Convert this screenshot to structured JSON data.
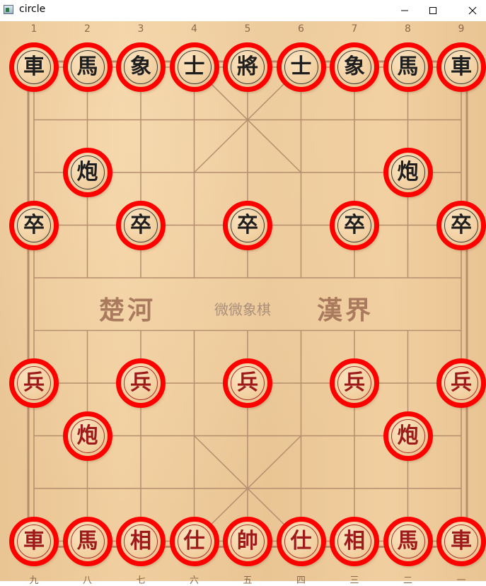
{
  "window": {
    "title": "circle",
    "buttons": [
      "minimize",
      "maximize",
      "close"
    ]
  },
  "board": {
    "top_numbers": [
      "1",
      "2",
      "3",
      "4",
      "5",
      "6",
      "7",
      "8",
      "9"
    ],
    "bottom_numbers": [
      "九",
      "八",
      "七",
      "六",
      "五",
      "四",
      "三",
      "二",
      "一"
    ],
    "river_left": "楚河",
    "river_center": "微微象棋",
    "river_right": "漢界"
  },
  "highlight_color": "#ff0000",
  "pieces": [
    {
      "id": "b-chariot-1",
      "char": "車",
      "side": "black",
      "file": 1,
      "rank": 0
    },
    {
      "id": "b-horse-1",
      "char": "馬",
      "side": "black",
      "file": 2,
      "rank": 0
    },
    {
      "id": "b-elephant-1",
      "char": "象",
      "side": "black",
      "file": 3,
      "rank": 0
    },
    {
      "id": "b-advisor-1",
      "char": "士",
      "side": "black",
      "file": 4,
      "rank": 0
    },
    {
      "id": "b-general",
      "char": "將",
      "side": "black",
      "file": 5,
      "rank": 0
    },
    {
      "id": "b-advisor-2",
      "char": "士",
      "side": "black",
      "file": 6,
      "rank": 0
    },
    {
      "id": "b-elephant-2",
      "char": "象",
      "side": "black",
      "file": 7,
      "rank": 0
    },
    {
      "id": "b-horse-2",
      "char": "馬",
      "side": "black",
      "file": 8,
      "rank": 0
    },
    {
      "id": "b-chariot-2",
      "char": "車",
      "side": "black",
      "file": 9,
      "rank": 0
    },
    {
      "id": "b-cannon-1",
      "char": "炮",
      "side": "black",
      "file": 2,
      "rank": 2
    },
    {
      "id": "b-cannon-2",
      "char": "炮",
      "side": "black",
      "file": 8,
      "rank": 2
    },
    {
      "id": "b-soldier-1",
      "char": "卒",
      "side": "black",
      "file": 1,
      "rank": 3
    },
    {
      "id": "b-soldier-2",
      "char": "卒",
      "side": "black",
      "file": 3,
      "rank": 3
    },
    {
      "id": "b-soldier-3",
      "char": "卒",
      "side": "black",
      "file": 5,
      "rank": 3
    },
    {
      "id": "b-soldier-4",
      "char": "卒",
      "side": "black",
      "file": 7,
      "rank": 3
    },
    {
      "id": "b-soldier-5",
      "char": "卒",
      "side": "black",
      "file": 9,
      "rank": 3
    },
    {
      "id": "r-soldier-1",
      "char": "兵",
      "side": "red",
      "file": 1,
      "rank": 6
    },
    {
      "id": "r-soldier-2",
      "char": "兵",
      "side": "red",
      "file": 3,
      "rank": 6
    },
    {
      "id": "r-soldier-3",
      "char": "兵",
      "side": "red",
      "file": 5,
      "rank": 6
    },
    {
      "id": "r-soldier-4",
      "char": "兵",
      "side": "red",
      "file": 7,
      "rank": 6
    },
    {
      "id": "r-soldier-5",
      "char": "兵",
      "side": "red",
      "file": 9,
      "rank": 6
    },
    {
      "id": "r-cannon-1",
      "char": "炮",
      "side": "red",
      "file": 2,
      "rank": 7
    },
    {
      "id": "r-cannon-2",
      "char": "炮",
      "side": "red",
      "file": 8,
      "rank": 7
    },
    {
      "id": "r-chariot-1",
      "char": "車",
      "side": "red",
      "file": 1,
      "rank": 9
    },
    {
      "id": "r-horse-1",
      "char": "馬",
      "side": "red",
      "file": 2,
      "rank": 9
    },
    {
      "id": "r-elephant-1",
      "char": "相",
      "side": "red",
      "file": 3,
      "rank": 9
    },
    {
      "id": "r-advisor-1",
      "char": "仕",
      "side": "red",
      "file": 4,
      "rank": 9
    },
    {
      "id": "r-general",
      "char": "帥",
      "side": "red",
      "file": 5,
      "rank": 9
    },
    {
      "id": "r-advisor-2",
      "char": "仕",
      "side": "red",
      "file": 6,
      "rank": 9
    },
    {
      "id": "r-elephant-2",
      "char": "相",
      "side": "red",
      "file": 7,
      "rank": 9
    },
    {
      "id": "r-horse-2",
      "char": "馬",
      "side": "red",
      "file": 8,
      "rank": 9
    },
    {
      "id": "r-chariot-2",
      "char": "車",
      "side": "red",
      "file": 9,
      "rank": 9
    }
  ]
}
